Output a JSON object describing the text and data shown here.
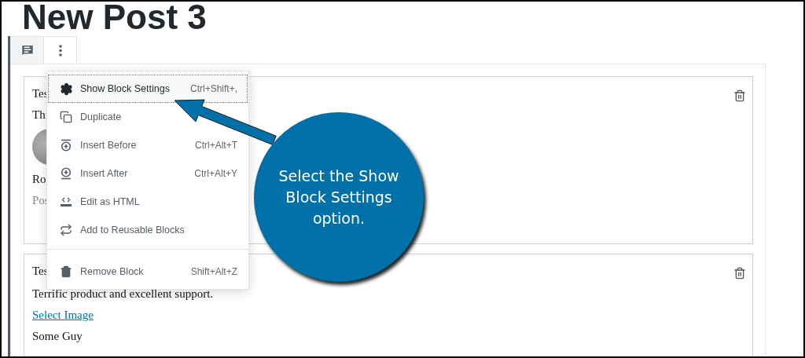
{
  "title": "New Post 3",
  "toolbar": [
    {
      "kind": "block-type",
      "selected": false
    },
    {
      "kind": "more",
      "selected": true
    }
  ],
  "blocks": [
    {
      "lines": [
        {
          "kind": "text",
          "text": "Tes"
        },
        {
          "kind": "text",
          "text": "Thi"
        },
        {
          "kind": "avatar"
        },
        {
          "kind": "text",
          "text": "Ro"
        },
        {
          "kind": "muted",
          "text": "Pos"
        }
      ]
    },
    {
      "lines": [
        {
          "kind": "text",
          "text": "Tes"
        },
        {
          "kind": "text",
          "text": "Terrific product and excellent support."
        },
        {
          "kind": "link",
          "text": "Select Image"
        },
        {
          "kind": "text",
          "text": "Some Guy"
        }
      ]
    }
  ],
  "menu": {
    "groups": [
      [
        {
          "kind": "settings",
          "label": "Show Block Settings",
          "shortcut": "Ctrl+Shift+,",
          "selected": true
        },
        {
          "kind": "duplicate",
          "label": "Duplicate",
          "selected": false
        },
        {
          "kind": "insert-before",
          "label": "Insert Before",
          "shortcut": "Ctrl+Alt+T",
          "selected": false
        },
        {
          "kind": "insert-after",
          "label": "Insert After",
          "shortcut": "Ctrl+Alt+Y",
          "selected": false
        },
        {
          "kind": "html",
          "label": "Edit as HTML",
          "selected": false
        },
        {
          "kind": "reusable",
          "label": "Add to Reusable Blocks",
          "selected": false
        }
      ],
      [
        {
          "kind": "remove",
          "label": "Remove Block",
          "shortcut": "Shift+Alt+Z",
          "selected": false
        }
      ]
    ]
  },
  "callout": {
    "text": "Select the Show Block Settings option."
  }
}
